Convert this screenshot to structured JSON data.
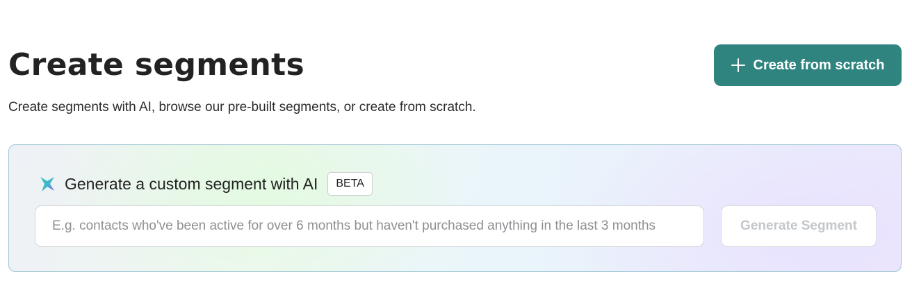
{
  "header": {
    "title": "Create segments",
    "subtitle": "Create segments with AI, browse our pre-built segments, or create from scratch.",
    "create_button": {
      "label": "Create from scratch",
      "icon": "plus-icon"
    }
  },
  "ai_generator": {
    "icon": "sparkle-icon",
    "title": "Generate a custom segment with AI",
    "badge": "BETA",
    "input": {
      "value": "",
      "placeholder": "E.g. contacts who've been active for over 6 months but haven't purchased anything in the last 3 months"
    },
    "generate_button": {
      "label": "Generate Segment",
      "disabled": true
    }
  },
  "colors": {
    "primary": "#2f8480",
    "text": "#222222",
    "card_border": "#9fc7d4",
    "disabled_text": "#c3c6ca"
  }
}
